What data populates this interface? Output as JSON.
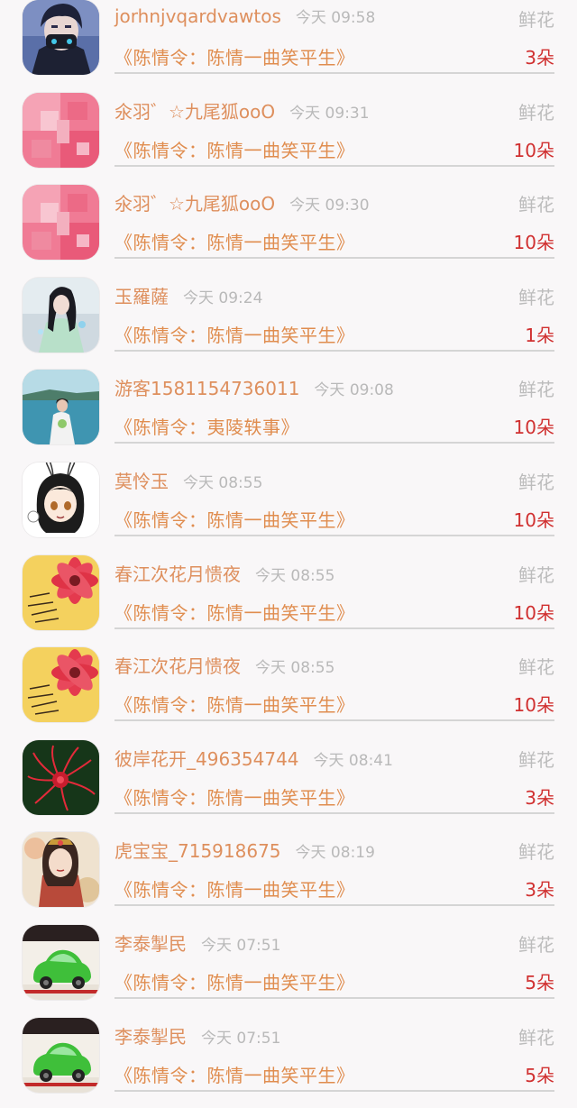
{
  "rows": [
    {
      "user": "jorhnjvqardvawtos",
      "time": "今天 09:58",
      "type": "鲜花",
      "book": "《陈情令：陈情一曲笑平生》",
      "count": "3朵",
      "avatar": "avatar-anime-boy-mask"
    },
    {
      "user": "氽羽゛☆九尾狐ooO",
      "time": "今天 09:31",
      "type": "鲜花",
      "book": "《陈情令：陈情一曲笑平生》",
      "count": "10朵",
      "avatar": "avatar-pink-blur"
    },
    {
      "user": "氽羽゛☆九尾狐ooO",
      "time": "今天 09:30",
      "type": "鲜花",
      "book": "《陈情令：陈情一曲笑平生》",
      "count": "10朵",
      "avatar": "avatar-pink-blur"
    },
    {
      "user": "玉羅薩",
      "time": "今天 09:24",
      "type": "鲜花",
      "book": "《陈情令：陈情一曲笑平生》",
      "count": "1朵",
      "avatar": "avatar-fantasy-girl"
    },
    {
      "user": "游客1581154736011",
      "time": "今天 09:08",
      "type": "鲜花",
      "book": "《陈情令：夷陵轶事》",
      "count": "10朵",
      "avatar": "avatar-bride-lake"
    },
    {
      "user": "莫怜玉",
      "time": "今天 08:55",
      "type": "鲜花",
      "book": "《陈情令：陈情一曲笑平生》",
      "count": "10朵",
      "avatar": "avatar-chibi-bunny"
    },
    {
      "user": "春江次花月愦夜",
      "time": "今天 08:55",
      "type": "鲜花",
      "book": "《陈情令：陈情一曲笑平生》",
      "count": "10朵",
      "avatar": "avatar-yellow-flower"
    },
    {
      "user": "春江次花月愦夜",
      "time": "今天 08:55",
      "type": "鲜花",
      "book": "《陈情令：陈情一曲笑平生》",
      "count": "10朵",
      "avatar": "avatar-yellow-flower"
    },
    {
      "user": "彼岸花开_496354744",
      "time": "今天 08:41",
      "type": "鲜花",
      "book": "《陈情令：陈情一曲笑平生》",
      "count": "3朵",
      "avatar": "avatar-red-spider-lily"
    },
    {
      "user": "虎宝宝_715918675",
      "time": "今天 08:19",
      "type": "鲜花",
      "book": "《陈情令：陈情一曲笑平生》",
      "count": "3朵",
      "avatar": "avatar-painted-lady"
    },
    {
      "user": "李泰掣民",
      "time": "今天 07:51",
      "type": "鲜花",
      "book": "《陈情令：陈情一曲笑平生》",
      "count": "5朵",
      "avatar": "avatar-green-toy-car"
    },
    {
      "user": "李泰掣民",
      "time": "今天 07:51",
      "type": "鲜花",
      "book": "《陈情令：陈情一曲笑平生》",
      "count": "5朵",
      "avatar": "avatar-green-toy-car"
    }
  ]
}
